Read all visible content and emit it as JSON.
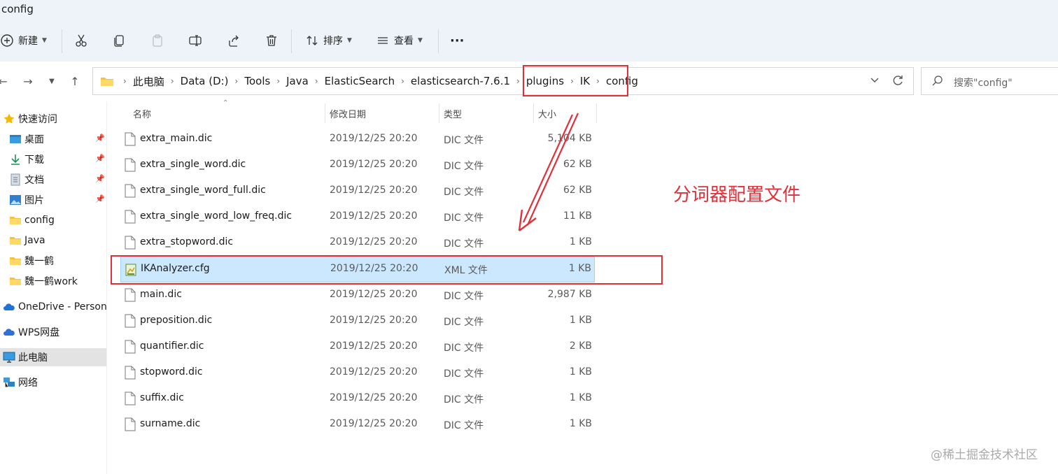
{
  "window": {
    "title": "config"
  },
  "toolbar": {
    "new_label": "新建",
    "sort_label": "排序",
    "view_label": "查看",
    "more_label": "···"
  },
  "address": {
    "crumbs": [
      "此电脑",
      "Data (D:)",
      "Tools",
      "Java",
      "ElasticSearch",
      "elasticsearch-7.6.1",
      "plugins",
      "IK",
      "config"
    ]
  },
  "search": {
    "placeholder": "搜索\"config\""
  },
  "sidebar": {
    "items": [
      {
        "label": "快速访问",
        "icon": "star-icon"
      },
      {
        "label": "桌面",
        "icon": "desktop-icon",
        "pinned": true
      },
      {
        "label": "下载",
        "icon": "download-icon",
        "pinned": true
      },
      {
        "label": "文档",
        "icon": "document-icon",
        "pinned": true
      },
      {
        "label": "图片",
        "icon": "picture-icon",
        "pinned": true
      },
      {
        "label": "config",
        "icon": "folder-icon"
      },
      {
        "label": "Java",
        "icon": "folder-icon"
      },
      {
        "label": "魏一鹤",
        "icon": "folder-icon"
      },
      {
        "label": "魏一鹤work",
        "icon": "folder-icon"
      },
      {
        "label": "OneDrive - Persona",
        "icon": "cloud-icon"
      },
      {
        "label": "WPS网盘",
        "icon": "cloud-icon"
      },
      {
        "label": "此电脑",
        "icon": "computer-icon",
        "selected": true
      },
      {
        "label": "网络",
        "icon": "network-icon"
      }
    ]
  },
  "columns": {
    "name": "名称",
    "date": "修改日期",
    "type": "类型",
    "size": "大小"
  },
  "files": [
    {
      "name": "extra_main.dic",
      "date": "2019/12/25 20:20",
      "type": "DIC 文件",
      "size": "5,104 KB"
    },
    {
      "name": "extra_single_word.dic",
      "date": "2019/12/25 20:20",
      "type": "DIC 文件",
      "size": "62 KB"
    },
    {
      "name": "extra_single_word_full.dic",
      "date": "2019/12/25 20:20",
      "type": "DIC 文件",
      "size": "62 KB"
    },
    {
      "name": "extra_single_word_low_freq.dic",
      "date": "2019/12/25 20:20",
      "type": "DIC 文件",
      "size": "11 KB"
    },
    {
      "name": "extra_stopword.dic",
      "date": "2019/12/25 20:20",
      "type": "DIC 文件",
      "size": "1 KB"
    },
    {
      "name": "IKAnalyzer.cfg",
      "date": "2019/12/25 20:20",
      "type": "XML 文件",
      "size": "1 KB",
      "selected": true
    },
    {
      "name": "main.dic",
      "date": "2019/12/25 20:20",
      "type": "DIC 文件",
      "size": "2,987 KB"
    },
    {
      "name": "preposition.dic",
      "date": "2019/12/25 20:20",
      "type": "DIC 文件",
      "size": "1 KB"
    },
    {
      "name": "quantifier.dic",
      "date": "2019/12/25 20:20",
      "type": "DIC 文件",
      "size": "2 KB"
    },
    {
      "name": "stopword.dic",
      "date": "2019/12/25 20:20",
      "type": "DIC 文件",
      "size": "1 KB"
    },
    {
      "name": "suffix.dic",
      "date": "2019/12/25 20:20",
      "type": "DIC 文件",
      "size": "1 KB"
    },
    {
      "name": "surname.dic",
      "date": "2019/12/25 20:20",
      "type": "DIC 文件",
      "size": "1 KB"
    }
  ],
  "annotation": {
    "text": "分词器配置文件",
    "color": "#e0303a"
  },
  "watermark": "@稀土掘金技术社区"
}
